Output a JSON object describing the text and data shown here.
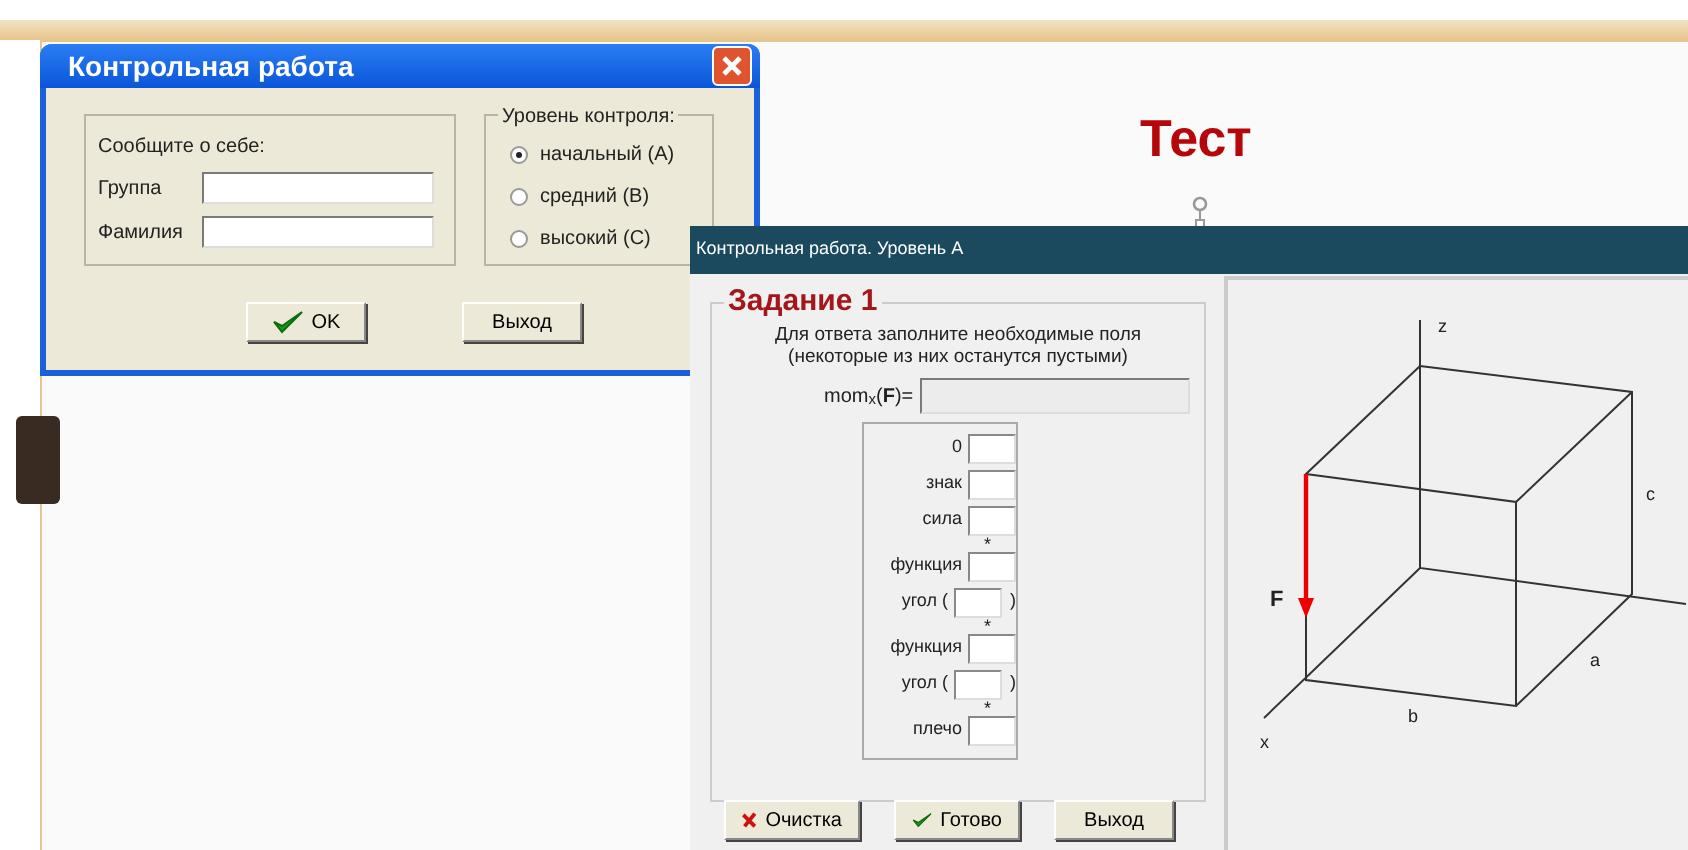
{
  "slide": {
    "title": "Тест"
  },
  "login_dialog": {
    "title": "Контрольная работа",
    "about_group": {
      "legend": "Сообщите о себе:",
      "fields": [
        {
          "label": "Группа"
        },
        {
          "label": "Фамилия"
        }
      ]
    },
    "level_group": {
      "legend": "Уровень контроля:",
      "options": [
        {
          "label": "начальный (А)",
          "selected": true
        },
        {
          "label": "средний (В)",
          "selected": false
        },
        {
          "label": "высокий (С)",
          "selected": false
        }
      ]
    },
    "buttons": [
      {
        "label": "OK",
        "kind": "ok"
      },
      {
        "label": "Выход",
        "kind": "plain"
      }
    ]
  },
  "task_window": {
    "title": "Контрольная работа. Уровень  А",
    "task": {
      "legend": "Задание 1",
      "instructions": [
        "Для ответа заполните необходимые поля",
        "(некоторые из них останутся пустыми)"
      ],
      "result": {
        "label": "mom$_{x}$(**F**)=",
        "disabled": true
      },
      "inputs": [
        {
          "label": "0"
        },
        {
          "label": "знак"
        },
        {
          "label": "сила"
        },
        {
          "above": "*",
          "label": "функция"
        },
        {
          "label": "угол (",
          "suffix": ")"
        },
        {
          "above": "*",
          "label": "функция"
        },
        {
          "label": "угол (",
          "suffix": ")"
        },
        {
          "above": "*",
          "label": "плечо"
        }
      ]
    },
    "buttons": [
      {
        "label": "Очистка",
        "kind": "clear"
      },
      {
        "label": "Готово",
        "kind": "ok"
      },
      {
        "label": "Выход",
        "kind": "plain"
      }
    ],
    "diagram": {
      "labels": [
        {
          "text": "z",
          "kind": "z"
        },
        {
          "text": "c",
          "kind": "c"
        },
        {
          "text": "F",
          "kind": "force"
        },
        {
          "text": "a",
          "kind": "a"
        },
        {
          "text": "b",
          "kind": "b"
        },
        {
          "text": "x",
          "kind": "x"
        }
      ]
    }
  }
}
